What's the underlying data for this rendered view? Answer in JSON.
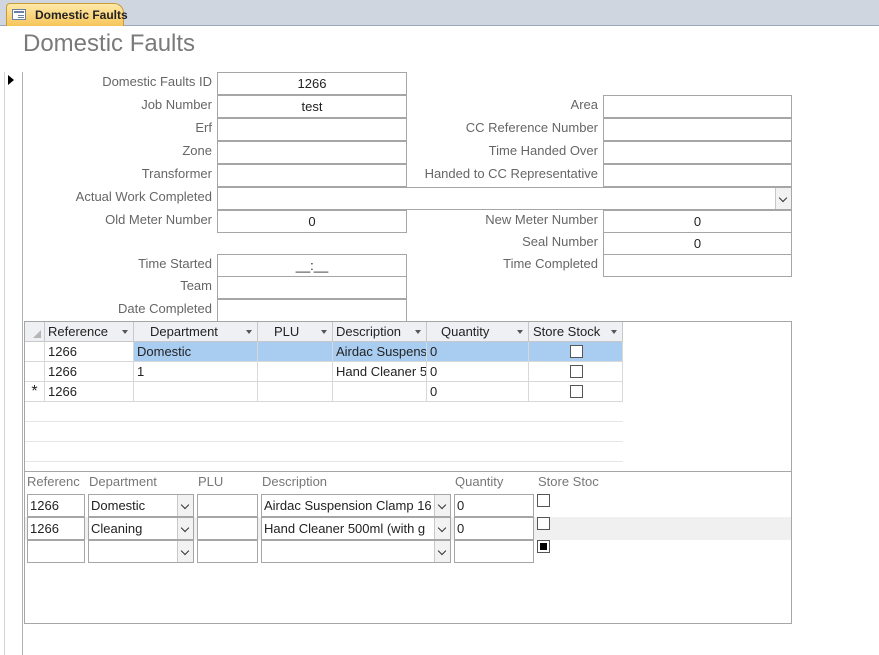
{
  "tab": {
    "label": "Domestic Faults"
  },
  "form": {
    "title": "Domestic Faults",
    "left_fields": [
      {
        "label": "Domestic Faults ID",
        "value": "1266"
      },
      {
        "label": "Job Number",
        "value": "test"
      },
      {
        "label": "Erf",
        "value": ""
      },
      {
        "label": "Zone",
        "value": ""
      },
      {
        "label": "Transformer",
        "value": ""
      }
    ],
    "right_fields": [
      {
        "label": "Area",
        "value": ""
      },
      {
        "label": "CC Reference Number",
        "value": ""
      },
      {
        "label": "Time Handed Over",
        "value": ""
      },
      {
        "label": "Handed to CC Representative",
        "value": ""
      }
    ],
    "actual_work_completed": {
      "label": "Actual Work Completed",
      "value": ""
    },
    "old_meter": {
      "label": "Old Meter Number",
      "value": "0"
    },
    "new_meter": {
      "label": "New Meter Number",
      "value": "0"
    },
    "seal_number": {
      "label": "Seal Number",
      "value": "0"
    },
    "time_started": {
      "label": "Time Started",
      "value": "__:__"
    },
    "time_completed": {
      "label": "Time Completed",
      "value": ""
    },
    "team": {
      "label": "Team",
      "value": ""
    },
    "date_completed": {
      "label": "Date Completed",
      "value": ""
    }
  },
  "datasheet": {
    "columns": [
      "Reference",
      "Department",
      "PLU",
      "Description",
      "Quantity",
      "Store Stock"
    ],
    "rows": [
      {
        "reference": "1266",
        "department": "Domestic",
        "plu": "",
        "description": "Airdac Suspens",
        "quantity": "0",
        "store_stock": false,
        "selected": true
      },
      {
        "reference": "1266",
        "department": "1",
        "plu": "",
        "description": "Hand Cleaner 5",
        "quantity": "0",
        "store_stock": false
      },
      {
        "reference": "1266",
        "department": "",
        "plu": "",
        "description": "",
        "quantity": "0",
        "store_stock": false,
        "new_record_marker": "*"
      }
    ]
  },
  "continuous_form": {
    "headers": [
      "Referenc",
      "Department",
      "PLU",
      "Description",
      "Quantity",
      "Store Stoc"
    ],
    "rows": [
      {
        "reference": "1266",
        "department": "Domestic",
        "plu": "",
        "description": "Airdac Suspension Clamp 16",
        "quantity": "0",
        "store_stock": false
      },
      {
        "reference": "1266",
        "department": "Cleaning",
        "plu": "",
        "description": "Hand Cleaner 500ml (with g",
        "quantity": "0",
        "store_stock": false
      },
      {
        "reference": "",
        "department": "",
        "plu": "",
        "description": "",
        "quantity": "",
        "store_stock": true
      }
    ]
  },
  "colors": {
    "tab_active": "#f6c55a",
    "selected_row": "#a9cdf1",
    "band_row": "#f0f0f0"
  }
}
